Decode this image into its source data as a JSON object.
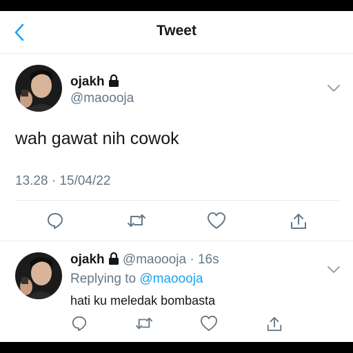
{
  "header": {
    "title": "Tweet"
  },
  "tweet": {
    "author_name": "ojakh",
    "author_handle": "@maoooja",
    "text": "wah gawat nih cowok",
    "timestamp": "13.28 · 15/04/22"
  },
  "reply": {
    "author_name": "ojakh",
    "meta": "@maoooja · 16s",
    "replying_prefix": "Replying to",
    "replying_to": "@maoooja",
    "text": "hati ku meledak bombasta"
  },
  "colors": {
    "accent": "#1da1f2",
    "secondary_text": "#657786",
    "divider": "#e6ecf0"
  },
  "icons": {
    "back": "chevron-left-icon",
    "lock": "lock-icon",
    "more": "chevron-down-icon",
    "reply": "comment-icon",
    "retweet": "retweet-icon",
    "like": "heart-icon",
    "share": "share-icon"
  }
}
